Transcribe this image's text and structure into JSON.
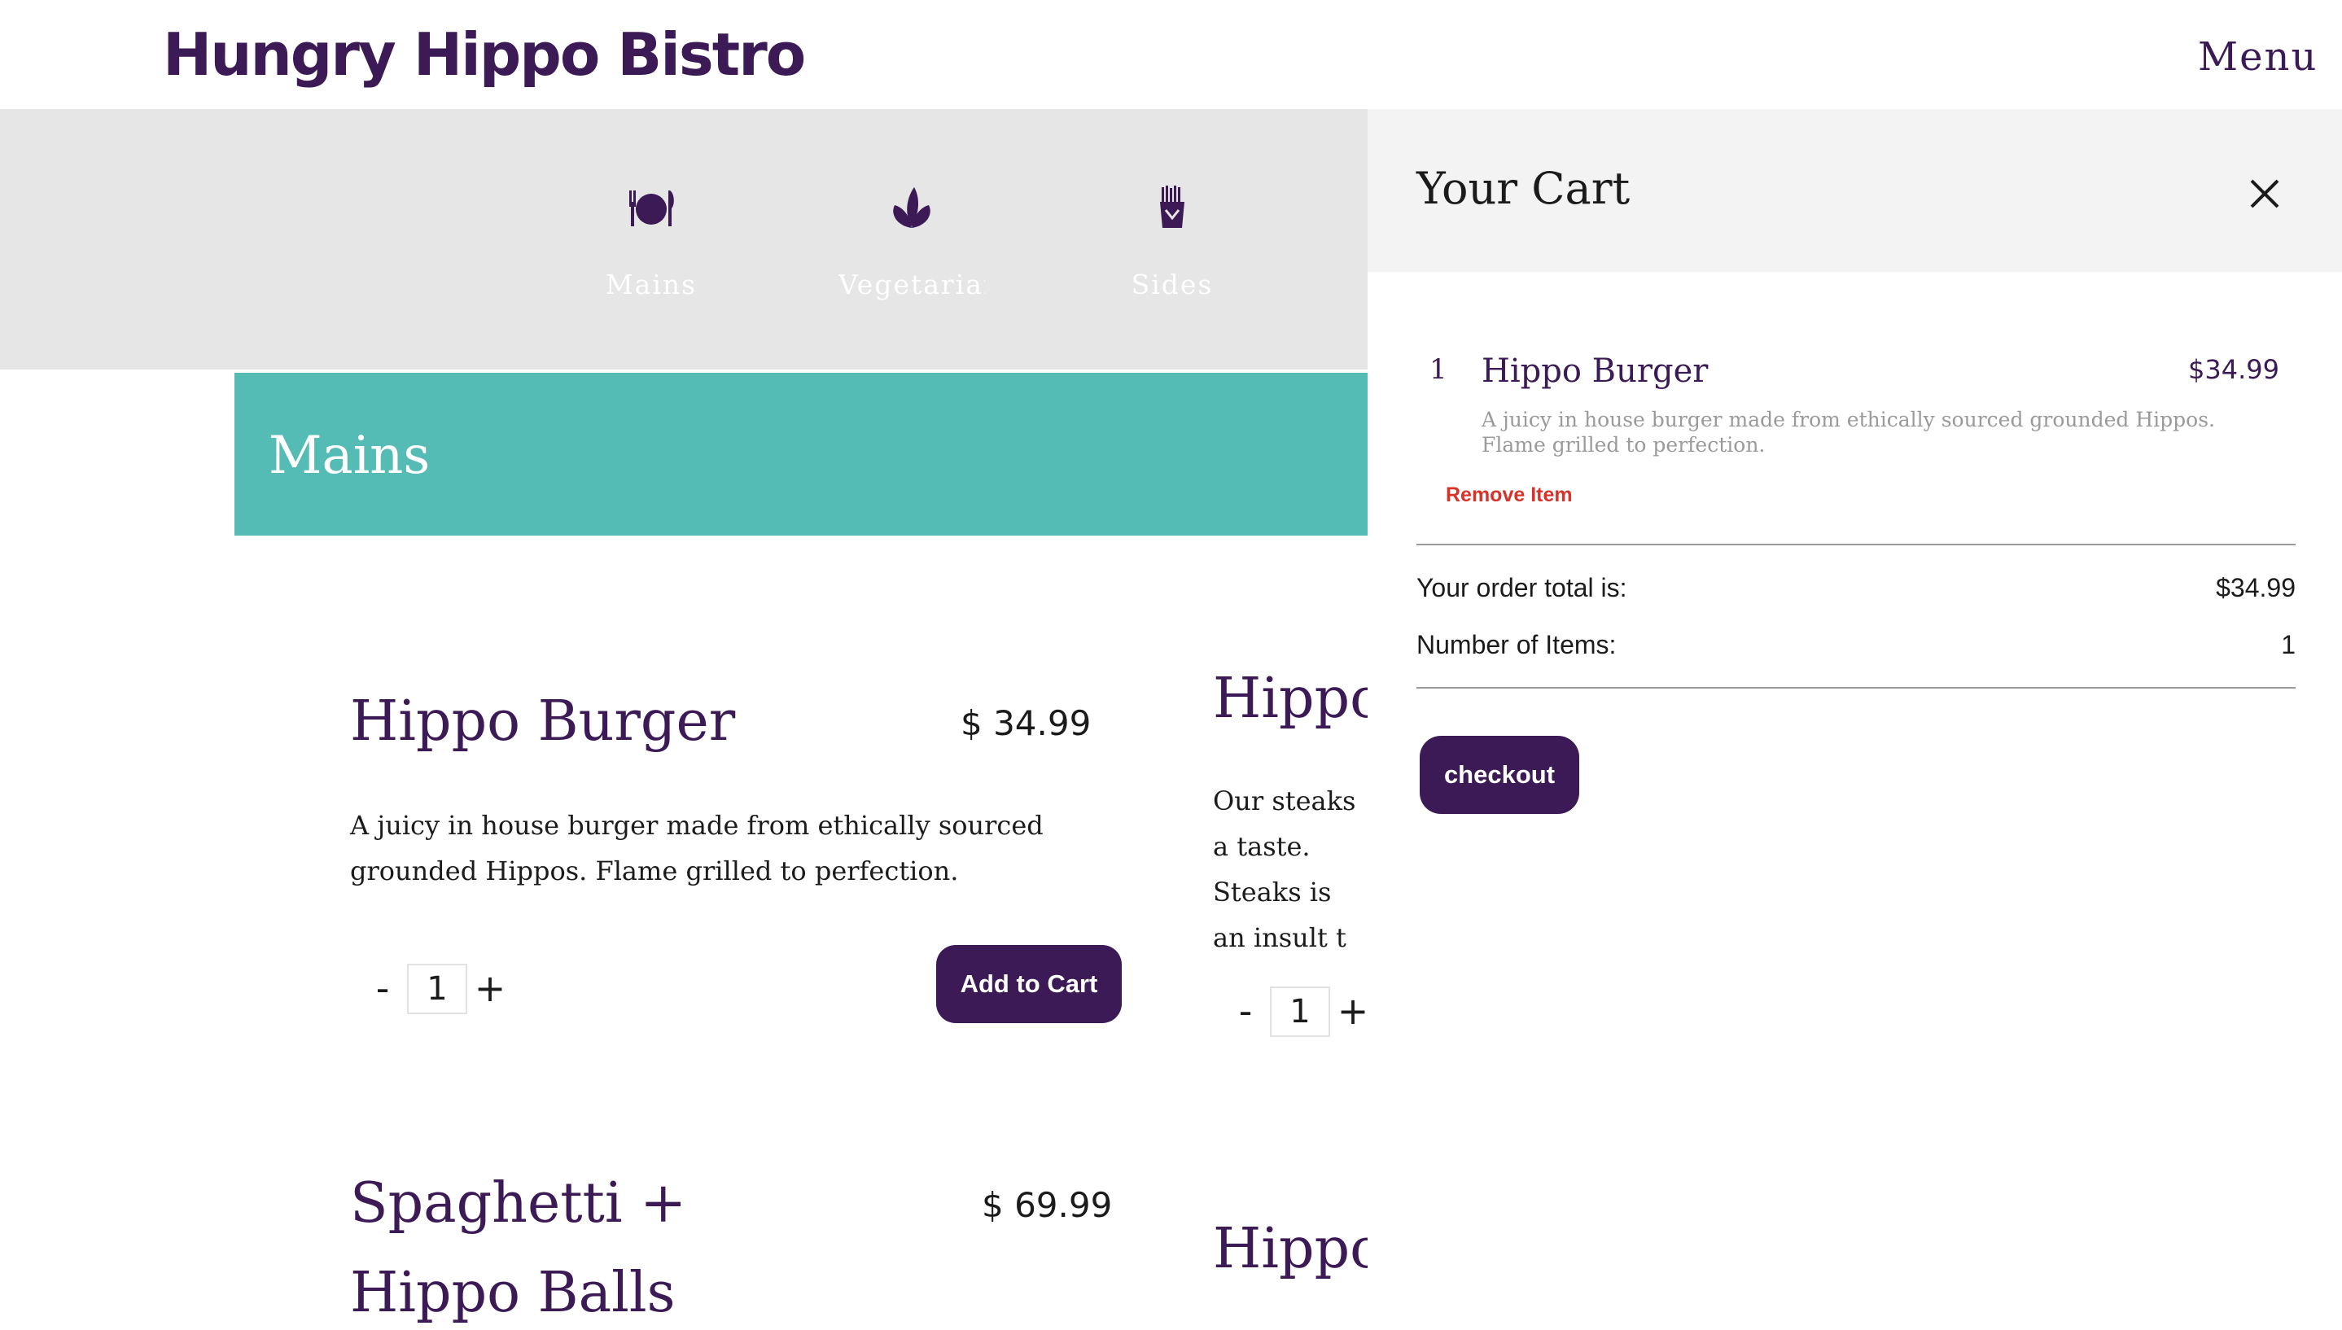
{
  "header": {
    "logo_text": "Hungry Hippo Bistro",
    "menu_label": "Menu"
  },
  "categories": [
    {
      "label": "Mains",
      "icon": "plate-cutlery-icon"
    },
    {
      "label": "Vegetarian",
      "icon": "leaf-icon"
    },
    {
      "label": "Sides",
      "icon": "fries-icon"
    }
  ],
  "section": {
    "title": "Mains"
  },
  "menu_items": [
    {
      "title": "Hippo Burger",
      "price": "$ 34.99",
      "description": "A juicy in house burger made from ethically sourced grounded Hippos. Flame grilled to perfection.",
      "quantity": "1",
      "add_label": "Add to Cart"
    },
    {
      "title": "Hippo",
      "description": "Our steaks a taste. Steaks is an insult t",
      "quantity": "1"
    },
    {
      "title": "Spaghetti + Hippo Balls",
      "price": "$ 69.99"
    },
    {
      "title": "Hippo"
    }
  ],
  "controls": {
    "minus": "-",
    "plus": "+"
  },
  "cart": {
    "title": "Your Cart",
    "items": [
      {
        "quantity": "1",
        "name": "Hippo Burger",
        "price": "$34.99",
        "description": "A juicy in house burger made from ethically sourced grounded Hippos. Flame grilled to perfection.",
        "remove_label": "Remove Item"
      }
    ],
    "total_label": "Your order total is:",
    "total_value": "$34.99",
    "count_label": "Number of Items:",
    "count_value": "1",
    "checkout_label": "checkout"
  },
  "colors": {
    "brand": "#3b1a55",
    "teal": "#54bbb5",
    "nav_bg": "#e6e6e6",
    "remove": "#d8322a"
  }
}
